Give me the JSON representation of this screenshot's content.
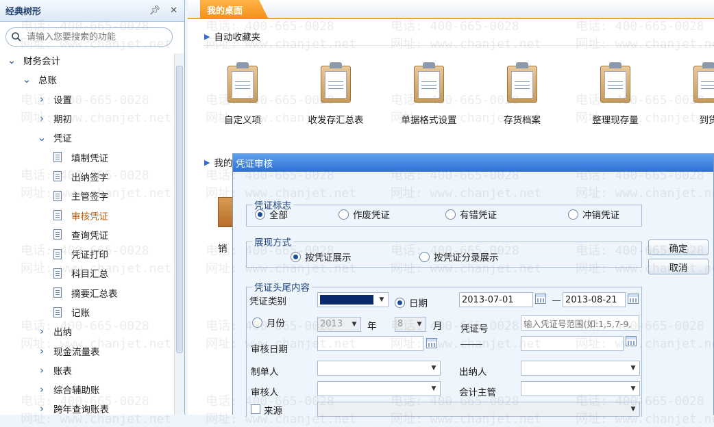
{
  "tree": {
    "title": "经典树形",
    "pin_icon": "pin-icon",
    "close_icon": "close-icon",
    "search_placeholder": "请输入您要搜索的功能",
    "nodes": [
      {
        "label": "财务会计",
        "level": 0,
        "arrow": "▼"
      },
      {
        "label": "总账",
        "level": 1,
        "arrow": "▼"
      },
      {
        "label": "设置",
        "level": 2,
        "arrow": "▶"
      },
      {
        "label": "期初",
        "level": 2,
        "arrow": "▶"
      },
      {
        "label": "凭证",
        "level": 2,
        "arrow": "▼"
      },
      {
        "label": "填制凭证",
        "level": 3,
        "doc": true
      },
      {
        "label": "出纳签字",
        "level": 3,
        "doc": true
      },
      {
        "label": "主管签字",
        "level": 3,
        "doc": true
      },
      {
        "label": "审核凭证",
        "level": 3,
        "doc": true,
        "selected": true
      },
      {
        "label": "查询凭证",
        "level": 3,
        "doc": true
      },
      {
        "label": "凭证打印",
        "level": 3,
        "doc": true
      },
      {
        "label": "科目汇总",
        "level": 3,
        "doc": true
      },
      {
        "label": "摘要汇总表",
        "level": 3,
        "doc": true
      },
      {
        "label": "记账",
        "level": 3,
        "doc": true
      },
      {
        "label": "出纳",
        "level": 2,
        "arrow": "▶"
      },
      {
        "label": "现金流量表",
        "level": 2,
        "arrow": "▶"
      },
      {
        "label": "账表",
        "level": 2,
        "arrow": "▶"
      },
      {
        "label": "综合辅助账",
        "level": 2,
        "arrow": "▶"
      },
      {
        "label": "跨年查询账表",
        "level": 2,
        "arrow": "▶"
      }
    ]
  },
  "main": {
    "tab": "我的桌面",
    "favorites_title": "自动收藏夹",
    "my_title": "我的",
    "hidden_item_partial": "销",
    "favorites": [
      "自定义项",
      "收发存汇总表",
      "单据格式设置",
      "存货档案",
      "整理现存量",
      "到货"
    ]
  },
  "dialog": {
    "title": "凭证审核",
    "flag_group": "凭证标志",
    "flags": [
      "全部",
      "作废凭证",
      "有错凭证",
      "冲销凭证"
    ],
    "flag_selected": 0,
    "display_group": "展现方式",
    "display_options": [
      "按凭证展示",
      "按凭证分录展示"
    ],
    "display_selected": 0,
    "ok": "确定",
    "cancel": "取消",
    "content_group": "凭证头尾内容",
    "voucher_type_label": "凭证类别",
    "date_radio": "日期",
    "date_from": "2013-07-01",
    "date_to": "2013-08-21",
    "month_radio": "月份",
    "year": "2013",
    "year_label": "年",
    "month": "8",
    "month_label": "月",
    "voucher_no_label": "凭证号",
    "voucher_no_placeholder": "输入凭证号范围(如:1,5,7-9,",
    "audit_date_label": "审核日期",
    "maker_label": "制单人",
    "cashier_label": "出纳人",
    "auditor_label": "审核人",
    "supervisor_label": "会计主管",
    "source_label": "来源"
  },
  "watermark": {
    "phone": "电话: 400-665-0028",
    "site": "网址: www.chanjet.net"
  },
  "colors": {
    "accent_orange": "#f39019",
    "title_blue": "#2d6fd6",
    "selected_text": "#c05a00"
  }
}
